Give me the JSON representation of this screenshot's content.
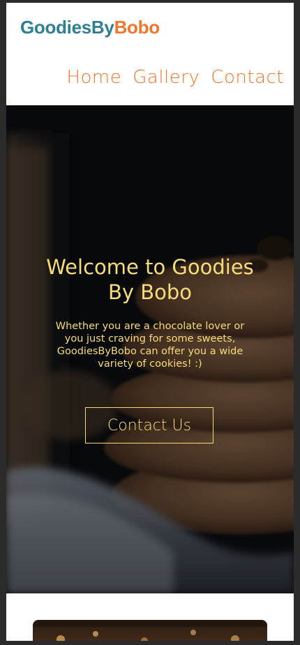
{
  "header": {
    "logo_part1": "GoodiesBy",
    "logo_part2": "Bobo",
    "nav": [
      {
        "label": "Home"
      },
      {
        "label": "Gallery"
      },
      {
        "label": "Contact"
      }
    ]
  },
  "hero": {
    "title": "Welcome to Goodies By Bobo",
    "text": "Whether you are a chocolate lover or you just craving for some sweets, GoodiesByBobo can offer you a wide variety of cookies! :)",
    "button_label": "Contact Us"
  },
  "colors": {
    "brand_teal": "#2f7f93",
    "brand_orange": "#f0772f",
    "hero_text": "#f7dc7a"
  }
}
